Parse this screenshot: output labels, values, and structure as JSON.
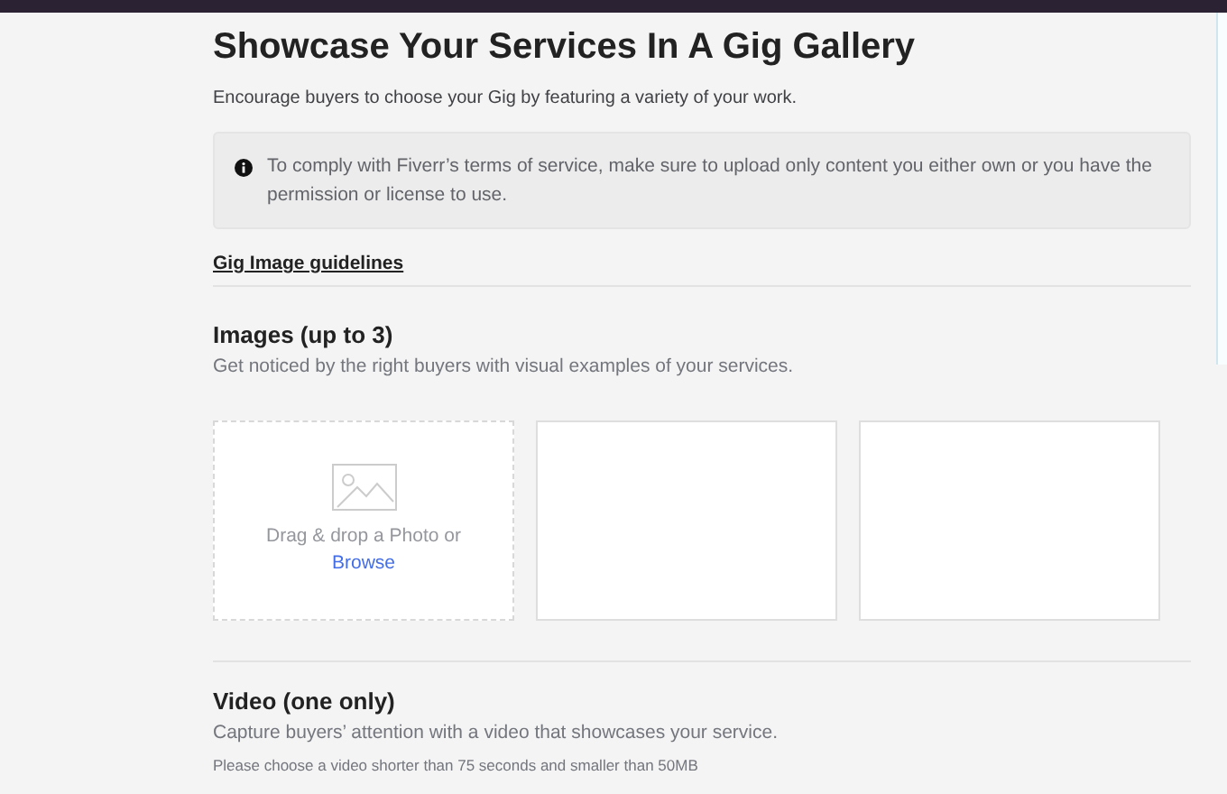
{
  "title": "Showcase Your Services In A Gig Gallery",
  "intro": "Encourage buyers to choose your Gig by featuring a variety of your work.",
  "notice": "To comply with Fiverr’s terms of service, make sure to upload only content you either own or you have the permission or license to use.",
  "guidelines_link": "Gig Image guidelines",
  "images": {
    "heading": "Images (up to 3)",
    "description": "Get noticed by the right buyers with visual examples of your services.",
    "slots": [
      {
        "kind": "dropzone",
        "prompt": "Drag & drop a Photo or",
        "link": "Browse"
      },
      {
        "kind": "empty"
      },
      {
        "kind": "empty"
      }
    ]
  },
  "video": {
    "heading": "Video (one only)",
    "description": "Capture buyers’ attention with a video that showcases your service.",
    "note": "Please choose a video shorter than 75 seconds and smaller than 50MB"
  }
}
